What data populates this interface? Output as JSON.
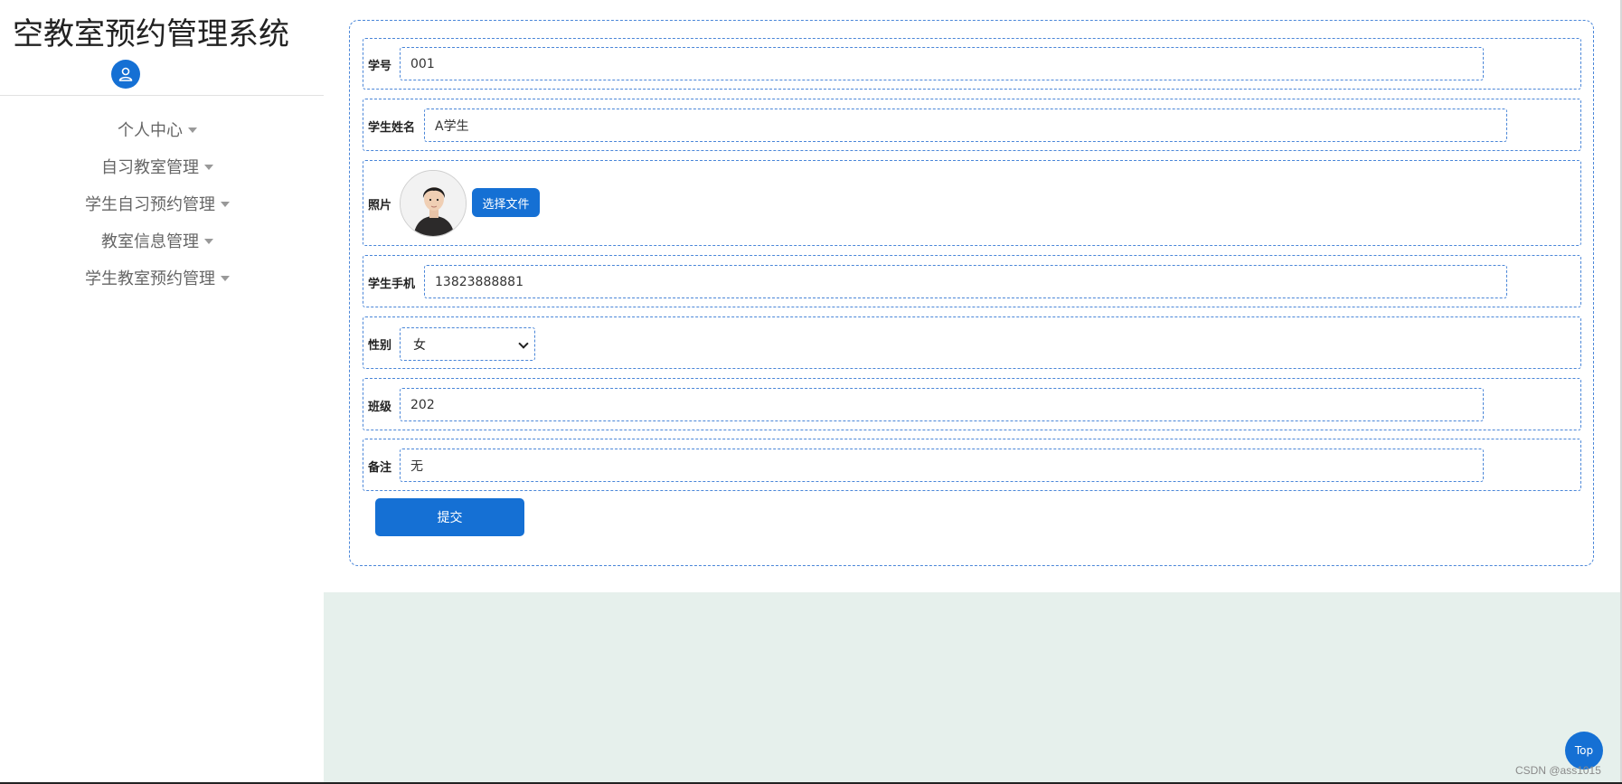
{
  "app": {
    "title": "空教室预约管理系统"
  },
  "sidebar": {
    "avatar_icon": "user-icon",
    "items": [
      {
        "label": "个人中心"
      },
      {
        "label": "自习教室管理"
      },
      {
        "label": "学生自习预约管理"
      },
      {
        "label": "教室信息管理"
      },
      {
        "label": "学生教室预约管理"
      }
    ]
  },
  "form": {
    "student_id": {
      "label": "学号",
      "value": "001"
    },
    "student_name": {
      "label": "学生姓名",
      "value": "A学生"
    },
    "photo": {
      "label": "照片",
      "button_label": "选择文件"
    },
    "phone": {
      "label": "学生手机",
      "value": "13823888881"
    },
    "gender": {
      "label": "性别",
      "value": "女"
    },
    "class": {
      "label": "班级",
      "value": "202"
    },
    "remark": {
      "label": "备注",
      "value": "无"
    },
    "submit_label": "提交"
  },
  "top_button": {
    "label": "Top"
  },
  "watermark": "CSDN @ass1015",
  "colors": {
    "accent": "#1570d4",
    "background": "#e6f0ec",
    "border": "#4a86d8"
  }
}
